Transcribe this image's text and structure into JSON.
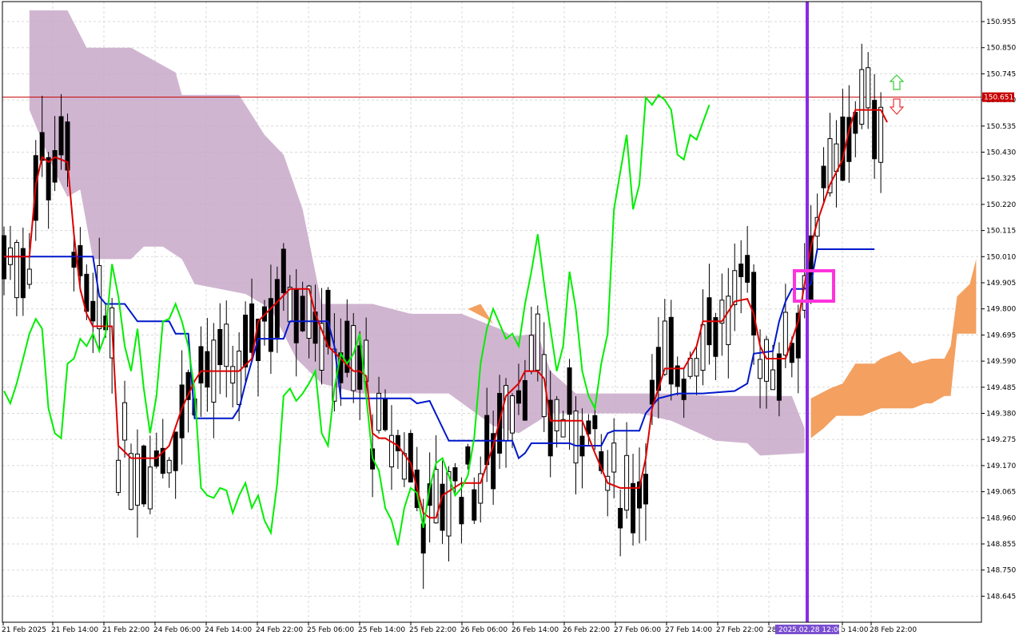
{
  "chart_data": {
    "type": "candlestick",
    "symbol_hint": "",
    "y_ticks": [
      "150.955",
      "150.850",
      "150.745",
      "150.640",
      "150.535",
      "150.430",
      "150.325",
      "150.220",
      "150.115",
      "150.010",
      "149.905",
      "149.800",
      "149.695",
      "149.590",
      "149.485",
      "149.380",
      "149.275",
      "149.170",
      "149.065",
      "148.960",
      "148.855",
      "148.750",
      "148.645"
    ],
    "ylim": [
      148.55,
      151.05
    ],
    "x_ticks": [
      "21 Feb 2025",
      "21 Feb 14:00",
      "21 Feb 22:00",
      "24 Feb 06:00",
      "24 Feb 14:00",
      "24 Feb 22:00",
      "25 Feb 06:00",
      "25 Feb 14:00",
      "25 Feb 22:00",
      "26 Feb 06:00",
      "26 Feb 14:00",
      "26 Feb 22:00",
      "27 Feb 06:00",
      "27 Feb 14:00",
      "27 Feb 22:00",
      "28",
      "b 14:00",
      "28 Feb 22:00"
    ],
    "current_price": {
      "label": "150.651",
      "value": 150.651,
      "color": "#c80000"
    },
    "cursor_time_label": "2025.02.28 12:00",
    "colors": {
      "tenkan": "#dd0000",
      "kijun": "#0018cc",
      "chikou": "#00ee00",
      "cloud_bear": "#c8a8c8",
      "cloud_bull": "#f4a060",
      "vline": "#8a2be2",
      "highlight": "#ff33dd",
      "bull_candle": "#ffffff",
      "bear_candle": "#000000",
      "grid": "#d8d8d8",
      "arrow_up": "#33cc33",
      "arrow_down": "#ee3333"
    },
    "tenkan": [
      [
        0,
        150.01
      ],
      [
        4,
        150.01
      ],
      [
        5,
        150.3
      ],
      [
        6,
        150.41
      ],
      [
        7,
        150.39
      ],
      [
        8,
        150.41
      ],
      [
        10,
        150.39
      ],
      [
        11,
        150.1
      ],
      [
        12,
        149.88
      ],
      [
        13,
        149.78
      ],
      [
        14,
        149.73
      ],
      [
        17,
        149.73
      ],
      [
        18,
        149.25
      ],
      [
        20,
        149.2
      ],
      [
        24,
        149.2
      ],
      [
        26,
        149.25
      ],
      [
        28,
        149.4
      ],
      [
        30,
        149.51
      ],
      [
        31,
        149.55
      ],
      [
        33,
        149.55
      ],
      [
        37,
        149.55
      ],
      [
        39,
        149.6
      ],
      [
        40,
        149.75
      ],
      [
        45,
        149.88
      ],
      [
        48,
        149.88
      ],
      [
        49,
        149.78
      ],
      [
        51,
        149.65
      ],
      [
        53,
        149.6
      ],
      [
        55,
        149.55
      ],
      [
        56,
        149.55
      ],
      [
        57,
        149.53
      ],
      [
        58,
        149.3
      ],
      [
        59,
        149.28
      ],
      [
        60,
        149.28
      ],
      [
        62,
        149.25
      ],
      [
        64,
        149.18
      ],
      [
        66,
        148.98
      ],
      [
        67,
        148.96
      ],
      [
        68,
        148.96
      ],
      [
        69,
        149.05
      ],
      [
        72,
        149.1
      ],
      [
        75,
        149.1
      ],
      [
        77,
        149.25
      ],
      [
        78,
        149.35
      ],
      [
        79,
        149.45
      ],
      [
        81,
        149.5
      ],
      [
        82,
        149.55
      ],
      [
        84,
        149.55
      ],
      [
        85,
        149.52
      ],
      [
        86,
        149.35
      ],
      [
        89,
        149.35
      ],
      [
        91,
        149.35
      ],
      [
        93,
        149.22
      ],
      [
        95,
        149.1
      ],
      [
        97,
        149.08
      ],
      [
        98,
        149.08
      ],
      [
        100,
        149.08
      ],
      [
        101,
        149.2
      ],
      [
        102,
        149.4
      ],
      [
        104,
        149.56
      ],
      [
        107,
        149.56
      ],
      [
        109,
        149.65
      ],
      [
        110,
        149.75
      ],
      [
        113,
        149.75
      ],
      [
        115,
        149.83
      ],
      [
        117,
        149.84
      ],
      [
        118,
        149.78
      ],
      [
        119,
        149.65
      ],
      [
        120,
        149.6
      ],
      [
        123,
        149.6
      ],
      [
        125,
        149.75
      ],
      [
        126,
        149.9
      ],
      [
        127,
        150.05
      ],
      [
        128,
        150.15
      ],
      [
        130,
        150.3
      ],
      [
        132,
        150.4
      ],
      [
        133,
        150.52
      ],
      [
        134,
        150.6
      ],
      [
        138,
        150.6
      ],
      [
        139,
        150.55
      ]
    ],
    "kijun": [
      [
        0,
        150.01
      ],
      [
        14,
        150.01
      ],
      [
        15,
        149.85
      ],
      [
        16,
        149.82
      ],
      [
        19,
        149.82
      ],
      [
        21,
        149.75
      ],
      [
        26,
        149.75
      ],
      [
        27,
        149.7
      ],
      [
        29,
        149.7
      ],
      [
        30,
        149.36
      ],
      [
        36,
        149.36
      ],
      [
        37,
        149.4
      ],
      [
        38,
        149.5
      ],
      [
        40,
        149.68
      ],
      [
        44,
        149.68
      ],
      [
        45,
        149.75
      ],
      [
        51,
        149.75
      ],
      [
        52,
        149.65
      ],
      [
        53,
        149.44
      ],
      [
        64,
        149.44
      ],
      [
        65,
        149.42
      ],
      [
        67,
        149.43
      ],
      [
        70,
        149.27
      ],
      [
        74,
        149.27
      ],
      [
        80,
        149.27
      ],
      [
        81,
        149.2
      ],
      [
        82,
        149.22
      ],
      [
        83,
        149.26
      ],
      [
        89,
        149.26
      ],
      [
        90,
        149.25
      ],
      [
        94,
        149.25
      ],
      [
        95,
        149.3
      ],
      [
        96,
        149.31
      ],
      [
        100,
        149.31
      ],
      [
        101,
        149.38
      ],
      [
        103,
        149.44
      ],
      [
        106,
        149.46
      ],
      [
        110,
        149.46
      ],
      [
        115,
        149.47
      ],
      [
        117,
        149.5
      ],
      [
        118,
        149.62
      ],
      [
        121,
        149.63
      ],
      [
        122,
        149.75
      ],
      [
        123,
        149.83
      ],
      [
        124,
        149.88
      ],
      [
        126,
        149.88
      ],
      [
        127,
        149.9
      ],
      [
        128,
        150.04
      ],
      [
        137,
        150.04
      ]
    ],
    "chikou": [
      [
        0,
        149.47
      ],
      [
        1,
        149.42
      ],
      [
        2,
        149.5
      ],
      [
        3,
        149.6
      ],
      [
        4,
        149.7
      ],
      [
        5,
        149.76
      ],
      [
        6,
        149.72
      ],
      [
        7,
        149.4
      ],
      [
        8,
        149.3
      ],
      [
        9,
        149.28
      ],
      [
        10,
        149.58
      ],
      [
        11,
        149.6
      ],
      [
        12,
        149.68
      ],
      [
        13,
        149.65
      ],
      [
        14,
        149.7
      ],
      [
        15,
        149.63
      ],
      [
        16,
        149.7
      ],
      [
        17,
        149.98
      ],
      [
        18,
        149.85
      ],
      [
        19,
        149.65
      ],
      [
        20,
        149.55
      ],
      [
        21,
        149.72
      ],
      [
        22,
        149.48
      ],
      [
        23,
        149.3
      ],
      [
        24,
        149.45
      ],
      [
        25,
        149.75
      ],
      [
        26,
        149.76
      ],
      [
        27,
        149.82
      ],
      [
        28,
        149.75
      ],
      [
        29,
        149.65
      ],
      [
        30,
        149.47
      ],
      [
        31,
        149.08
      ],
      [
        32,
        149.05
      ],
      [
        33,
        149.04
      ],
      [
        34,
        149.08
      ],
      [
        35,
        149.07
      ],
      [
        36,
        148.98
      ],
      [
        37,
        149.05
      ],
      [
        38,
        149.1
      ],
      [
        39,
        149.0
      ],
      [
        40,
        149.05
      ],
      [
        41,
        148.95
      ],
      [
        42,
        148.9
      ],
      [
        43,
        149.1
      ],
      [
        44,
        149.45
      ],
      [
        45,
        149.48
      ],
      [
        46,
        149.43
      ],
      [
        47,
        149.46
      ],
      [
        48,
        149.5
      ],
      [
        49,
        149.55
      ],
      [
        50,
        149.3
      ],
      [
        51,
        149.25
      ],
      [
        52,
        149.48
      ],
      [
        53,
        149.62
      ],
      [
        54,
        149.58
      ],
      [
        55,
        149.62
      ],
      [
        56,
        149.7
      ],
      [
        57,
        149.45
      ],
      [
        58,
        149.2
      ],
      [
        59,
        149.15
      ],
      [
        60,
        149.0
      ],
      [
        61,
        148.95
      ],
      [
        62,
        148.85
      ],
      [
        63,
        149.0
      ],
      [
        64,
        149.08
      ],
      [
        65,
        149.06
      ],
      [
        66,
        148.92
      ],
      [
        67,
        149.08
      ],
      [
        68,
        149.18
      ],
      [
        69,
        149.2
      ],
      [
        70,
        149.13
      ],
      [
        71,
        149.05
      ],
      [
        72,
        149.08
      ],
      [
        73,
        149.13
      ],
      [
        74,
        149.28
      ],
      [
        75,
        149.58
      ],
      [
        76,
        149.72
      ],
      [
        77,
        149.8
      ],
      [
        78,
        149.74
      ],
      [
        79,
        149.68
      ],
      [
        80,
        149.7
      ],
      [
        81,
        149.65
      ],
      [
        82,
        149.82
      ],
      [
        83,
        149.95
      ],
      [
        84,
        150.1
      ],
      [
        85,
        149.9
      ],
      [
        86,
        149.72
      ],
      [
        87,
        149.55
      ],
      [
        88,
        149.65
      ],
      [
        89,
        149.95
      ],
      [
        90,
        149.8
      ],
      [
        91,
        149.55
      ],
      [
        92,
        149.45
      ],
      [
        93,
        149.4
      ],
      [
        94,
        149.58
      ],
      [
        95,
        149.7
      ],
      [
        96,
        150.2
      ],
      [
        97,
        150.35
      ],
      [
        98,
        150.5
      ],
      [
        99,
        150.2
      ],
      [
        100,
        150.3
      ],
      [
        101,
        150.65
      ],
      [
        102,
        150.62
      ],
      [
        103,
        150.66
      ],
      [
        104,
        150.64
      ],
      [
        105,
        150.6
      ],
      [
        106,
        150.42
      ],
      [
        107,
        150.4
      ],
      [
        108,
        150.5
      ],
      [
        109,
        150.48
      ],
      [
        110,
        150.55
      ],
      [
        111,
        150.62
      ]
    ]
  }
}
